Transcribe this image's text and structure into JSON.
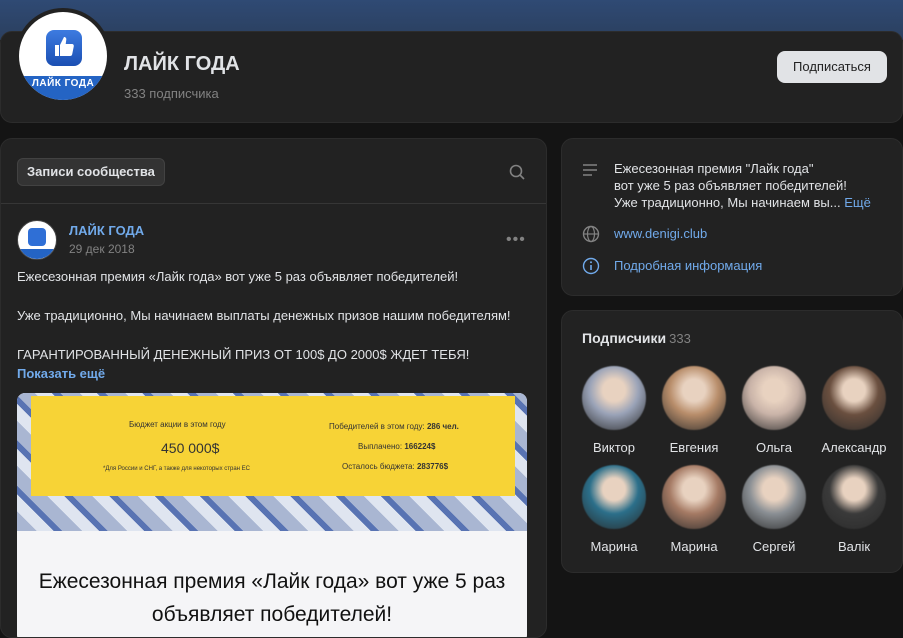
{
  "group": {
    "name": "ЛАЙК ГОДА",
    "subscribers": "333 подписчика",
    "logo_text": "ЛАЙК ГОДА",
    "subscribe_label": "Подписаться"
  },
  "feed": {
    "tab_label": "Записи сообщества",
    "post": {
      "author": "ЛАЙК ГОДА",
      "date": "29 дек 2018",
      "line1": "Ежесезонная премия «Лайк года» вот уже 5 раз объявляет победителей!",
      "line2": "Уже традиционно, Мы начинаем выплаты денежных призов нашим победителям!",
      "line3": "ГАРАНТИРОВАННЫЙ ДЕНЕЖНЫЙ ПРИЗ ОТ 100$ ДО 2000$ ЖДЕТ ТЕБЯ!",
      "show_more": "Показать ещё",
      "image": {
        "budget_label": "Бюджет акции в этом году",
        "budget_value": "450 000$",
        "budget_note": "*Для России и СНГ, а также для некоторых стран ЕС",
        "winners_label": "Победителей в этом году:",
        "winners_value": "286 чел.",
        "paid_label": "Выплачено:",
        "paid_value": "166224$",
        "remaining_label": "Осталось бюджета:",
        "remaining_value": "283776$",
        "headline_1": "Ежесезонная премия «Лайк года» вот уже 5 раз",
        "headline_2": "объявляет победителей!"
      }
    }
  },
  "info": {
    "description_1": "Ежесезонная премия \"Лайк года\"",
    "description_2": "вот уже 5 раз объявляет победителей!",
    "description_3": "Уже традиционно, Мы начинаем вы...",
    "more_link": "Ещё",
    "website": "www.denigi.club",
    "details_link": "Подробная информация"
  },
  "subscribers": {
    "title": "Подписчики",
    "count": "333",
    "people": [
      {
        "name": "Виктор",
        "color": "#9aa3b8"
      },
      {
        "name": "Евгения",
        "color": "#b88d6a"
      },
      {
        "name": "Ольга",
        "color": "#c9b3a8"
      },
      {
        "name": "Александр",
        "color": "#6a4f3f"
      },
      {
        "name": "Марина",
        "color": "#2b6f8a"
      },
      {
        "name": "Марина",
        "color": "#a57a64"
      },
      {
        "name": "Сергей",
        "color": "#8a8f94"
      },
      {
        "name": "Валік",
        "color": "#3a3a3a"
      }
    ]
  }
}
